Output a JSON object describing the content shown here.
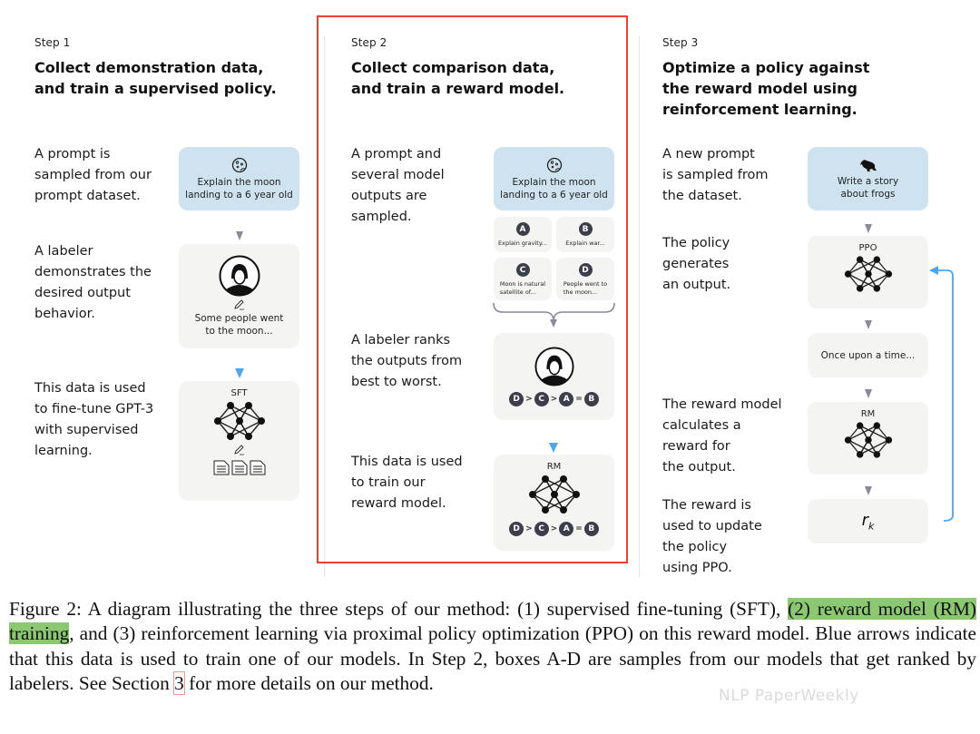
{
  "steps": [
    {
      "label": "Step 1",
      "title_lines": [
        "Collect demonstration data,",
        "and train a supervised policy."
      ],
      "descriptions": [
        [
          "A prompt is",
          "sampled from our",
          "prompt dataset."
        ],
        [
          "A labeler",
          "demonstrates the",
          "desired output",
          "behavior."
        ],
        [
          "This data is used",
          "to fine-tune GPT-3",
          "with supervised",
          "learning."
        ]
      ],
      "prompt_card": {
        "icon": "moon-icon",
        "lines": [
          "Explain the moon",
          "landing to a 6 year old"
        ]
      },
      "labeler_card": {
        "icon": "labeler-avatar",
        "lines": [
          "Some people went",
          "to the moon..."
        ]
      },
      "model_card": {
        "label": "SFT"
      }
    },
    {
      "label": "Step 2",
      "title_lines": [
        "Collect comparison data,",
        "and train a reward model."
      ],
      "descriptions": [
        [
          "A prompt and",
          "several model",
          "outputs are",
          "sampled."
        ],
        [
          "A labeler ranks",
          "the outputs from",
          "best to worst."
        ],
        [
          "This data is used",
          "to train our",
          "reward model."
        ]
      ],
      "prompt_card": {
        "icon": "moon-icon",
        "lines": [
          "Explain the moon",
          "landing to a 6 year old"
        ]
      },
      "outputs": [
        {
          "letter": "A",
          "lines": [
            "Explain gravity..."
          ]
        },
        {
          "letter": "B",
          "lines": [
            "Explain war..."
          ]
        },
        {
          "letter": "C",
          "lines": [
            "Moon is natural",
            "satellite of..."
          ]
        },
        {
          "letter": "D",
          "lines": [
            "People went to",
            "the moon..."
          ]
        }
      ],
      "ranking": [
        {
          "letter": "D",
          "op": ">"
        },
        {
          "letter": "C",
          "op": ">"
        },
        {
          "letter": "A",
          "op": "="
        },
        {
          "letter": "B",
          "op": ""
        }
      ],
      "model_card": {
        "label": "RM"
      }
    },
    {
      "label": "Step 3",
      "title_lines": [
        "Optimize a policy against",
        "the reward model using",
        "reinforcement learning."
      ],
      "descriptions": [
        [
          "A new prompt",
          "is sampled from",
          "the dataset."
        ],
        [
          "The policy",
          "generates",
          "an output."
        ],
        [
          "The reward model",
          "calculates a",
          "reward for",
          "the output."
        ],
        [
          "The reward is",
          "used to update",
          "the policy",
          "using PPO."
        ]
      ],
      "prompt_card": {
        "icon": "frog-icon",
        "lines": [
          "Write a story",
          "about frogs"
        ]
      },
      "policy_card": {
        "label": "PPO"
      },
      "output_card": {
        "lines": [
          "Once upon a time..."
        ]
      },
      "rm_card": {
        "label": "RM"
      },
      "reward_card": {
        "symbol": "r",
        "subscript": "k"
      }
    }
  ],
  "caption": {
    "segments": [
      {
        "text": "Figure 2: A diagram illustrating the three steps of our method: (1) supervised fine-tuning (SFT), ",
        "style": "plain"
      },
      {
        "text": "(2) reward model (RM) training",
        "style": "highlight"
      },
      {
        "text": ", and (3) reinforcement learning via proximal policy optimization (PPO) on this reward model. Blue arrows indicate that this data is used to train one of our models. In Step 2, boxes A-D are samples from our models that get ranked by labelers. See Section ",
        "style": "plain"
      },
      {
        "text": "3",
        "style": "ref"
      },
      {
        "text": " for more details on our method.",
        "style": "plain"
      }
    ]
  },
  "watermark": "NLP PaperWeekly",
  "colors": {
    "highlight": "#8cc772",
    "emphasis_box": "#e8432e",
    "blue_arrow": "#4aa8f0",
    "prompt_card": "#cfe2f0",
    "card": "#f4f4f3"
  }
}
